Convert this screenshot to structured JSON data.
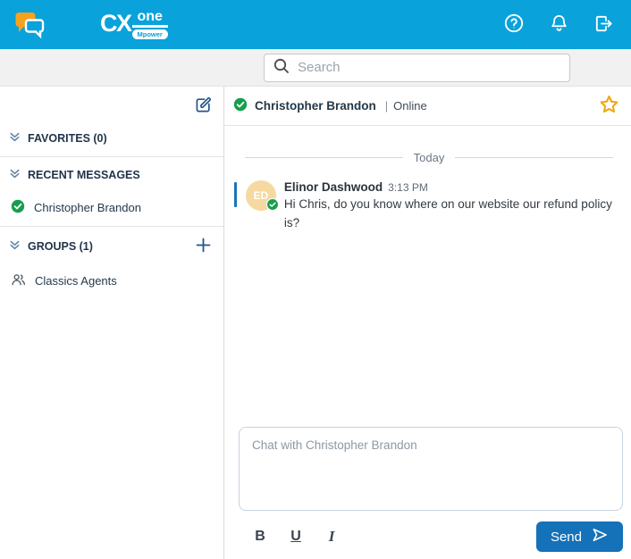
{
  "app": {
    "logo_cx": "CX",
    "logo_one": "one",
    "logo_mpower": "Mpower"
  },
  "search": {
    "placeholder": "Search"
  },
  "sidebar": {
    "favorites_label": "FAVORITES (0)",
    "recent_label": "RECENT MESSAGES",
    "groups_label": "GROUPS (1)",
    "recent_items": [
      {
        "name": "Christopher Brandon",
        "status": "online"
      }
    ],
    "group_items": [
      {
        "name": "Classics Agents"
      }
    ]
  },
  "chat": {
    "contact_name": "Christopher Brandon",
    "separator": "|",
    "presence": "Online",
    "day_divider": "Today",
    "messages": [
      {
        "sender": "Elinor Dashwood",
        "time": "3:13 PM",
        "initials": "ED",
        "text": "Hi Chris, do you know where on our website our refund policy is?"
      }
    ],
    "composer": {
      "placeholder": "Chat with Christopher Brandon",
      "bold_label": "B",
      "underline_label": "U",
      "italic_label": "I",
      "send_label": "Send"
    }
  },
  "colors": {
    "header_blue": "#0AA2DB",
    "accent_blue": "#1571B8",
    "navy_text": "#1F3349",
    "online_green": "#169E4D",
    "star_gold": "#EDA812",
    "avatar_tan": "#F5D9A0",
    "bubble_orange": "#F6A21D"
  }
}
